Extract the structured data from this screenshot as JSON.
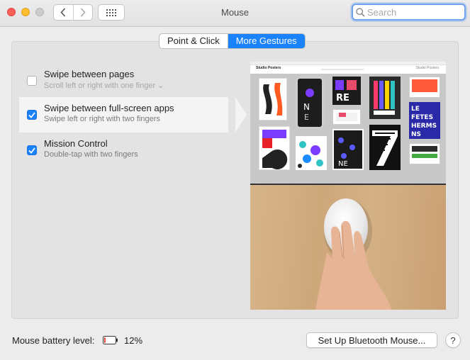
{
  "window": {
    "title": "Mouse"
  },
  "search": {
    "placeholder": "Search",
    "value": ""
  },
  "tabs": [
    {
      "label": "Point & Click",
      "active": false
    },
    {
      "label": "More Gestures",
      "active": true
    }
  ],
  "options": [
    {
      "title": "Swipe between pages",
      "subtitle": "Scroll left or right with one finger ⌄",
      "checked": false,
      "selected": false
    },
    {
      "title": "Swipe between full-screen apps",
      "subtitle": "Swipe left or right with two fingers",
      "checked": true,
      "selected": true
    },
    {
      "title": "Mission Control",
      "subtitle": "Double-tap with two fingers",
      "checked": true,
      "selected": false
    }
  ],
  "preview": {
    "site_name": "Studio Posters"
  },
  "footer": {
    "battery_label": "Mouse battery level:",
    "battery_percent": "12%",
    "battery_level": 0.12,
    "setup_button": "Set Up Bluetooth Mouse...",
    "help_label": "?"
  },
  "colors": {
    "accent": "#1a82fb",
    "battery_low": "#e0312b"
  }
}
